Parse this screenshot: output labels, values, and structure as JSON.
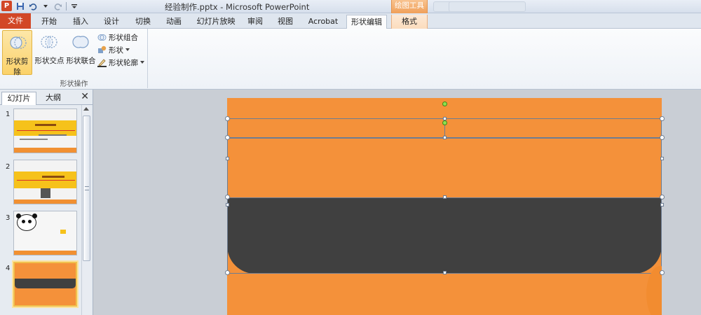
{
  "titlebar": {
    "app_icon": "P",
    "title": "经验制作.pptx - Microsoft PowerPoint",
    "context_header": "绘图工具"
  },
  "tabs": [
    {
      "label": "文件"
    },
    {
      "label": "开始"
    },
    {
      "label": "插入"
    },
    {
      "label": "设计"
    },
    {
      "label": "切换"
    },
    {
      "label": "动画"
    },
    {
      "label": "幻灯片放映"
    },
    {
      "label": "审阅"
    },
    {
      "label": "视图"
    },
    {
      "label": "Acrobat"
    },
    {
      "label": "形状编辑"
    },
    {
      "label": "格式"
    }
  ],
  "ribbon": {
    "big_buttons": [
      {
        "label": "形状剪除",
        "icon": "shape-subtract-icon"
      },
      {
        "label": "形状交点",
        "icon": "shape-intersect-icon"
      },
      {
        "label": "形状联合",
        "icon": "shape-union-icon"
      }
    ],
    "small_buttons": [
      {
        "label": "形状组合",
        "icon": "shape-combine-icon"
      },
      {
        "label": "形状",
        "icon": "shapes-icon"
      },
      {
        "label": "形状轮廓",
        "icon": "shape-outline-icon"
      }
    ],
    "group_label": "形状操作"
  },
  "left_panel": {
    "tab_slides": "幻灯片",
    "tab_outline": "大纲",
    "close": "✕",
    "slides": [
      {
        "number": "1"
      },
      {
        "number": "2"
      },
      {
        "number": "3"
      },
      {
        "number": "4",
        "selected": true
      }
    ]
  },
  "colors": {
    "orange": "#f4913a",
    "dark_bar": "#404040",
    "file_tab": "#d24726",
    "selection_yellow": "#f0c14d"
  }
}
